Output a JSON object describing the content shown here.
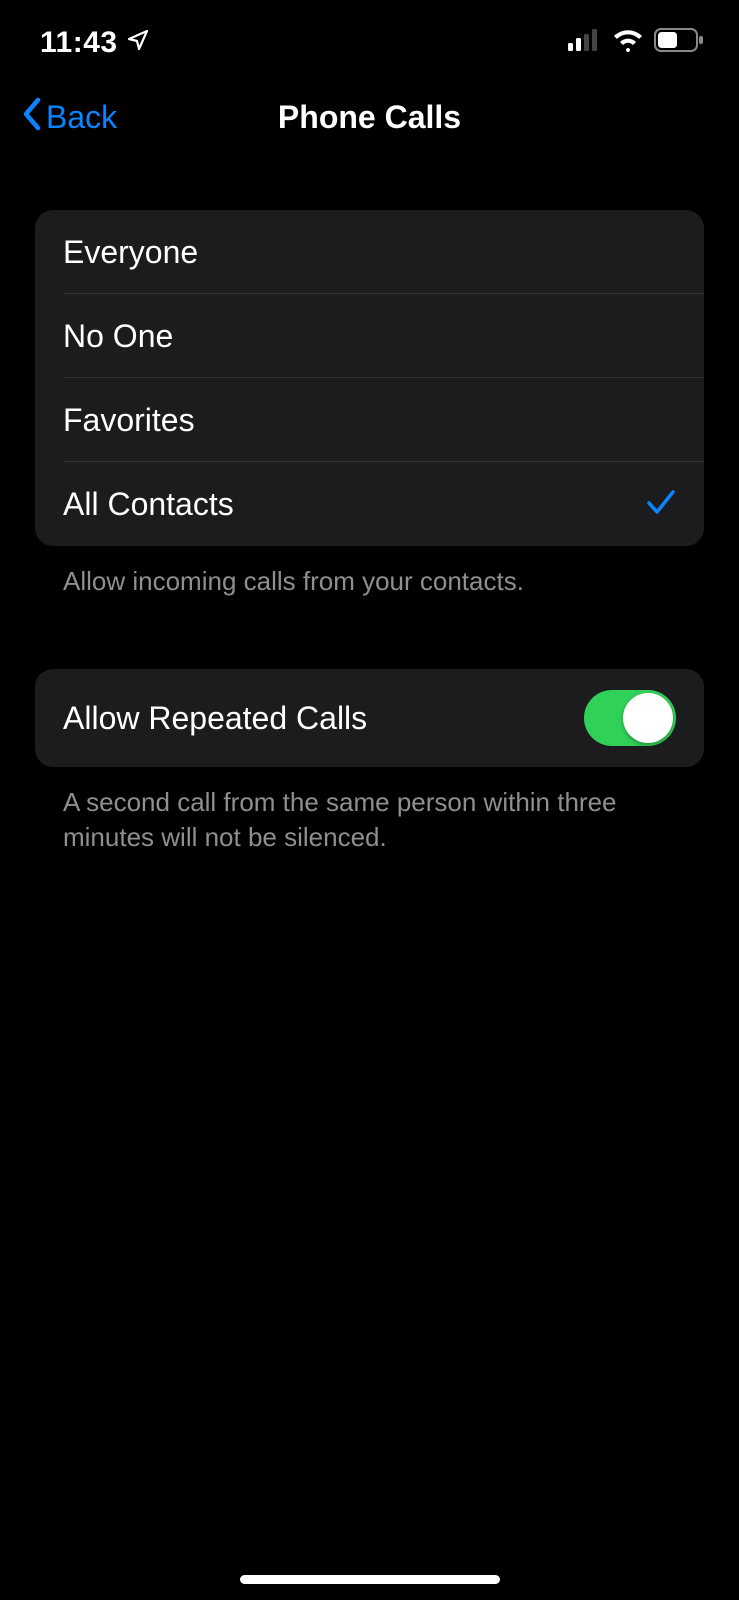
{
  "status": {
    "time": "11:43"
  },
  "nav": {
    "back_label": "Back",
    "title": "Phone Calls"
  },
  "allow_from": {
    "options": [
      {
        "label": "Everyone",
        "selected": false
      },
      {
        "label": "No One",
        "selected": false
      },
      {
        "label": "Favorites",
        "selected": false
      },
      {
        "label": "All Contacts",
        "selected": true
      }
    ],
    "footer": "Allow incoming calls from your contacts."
  },
  "repeated": {
    "label": "Allow Repeated Calls",
    "enabled": true,
    "footer": "A second call from the same person within three minutes will not be silenced."
  }
}
